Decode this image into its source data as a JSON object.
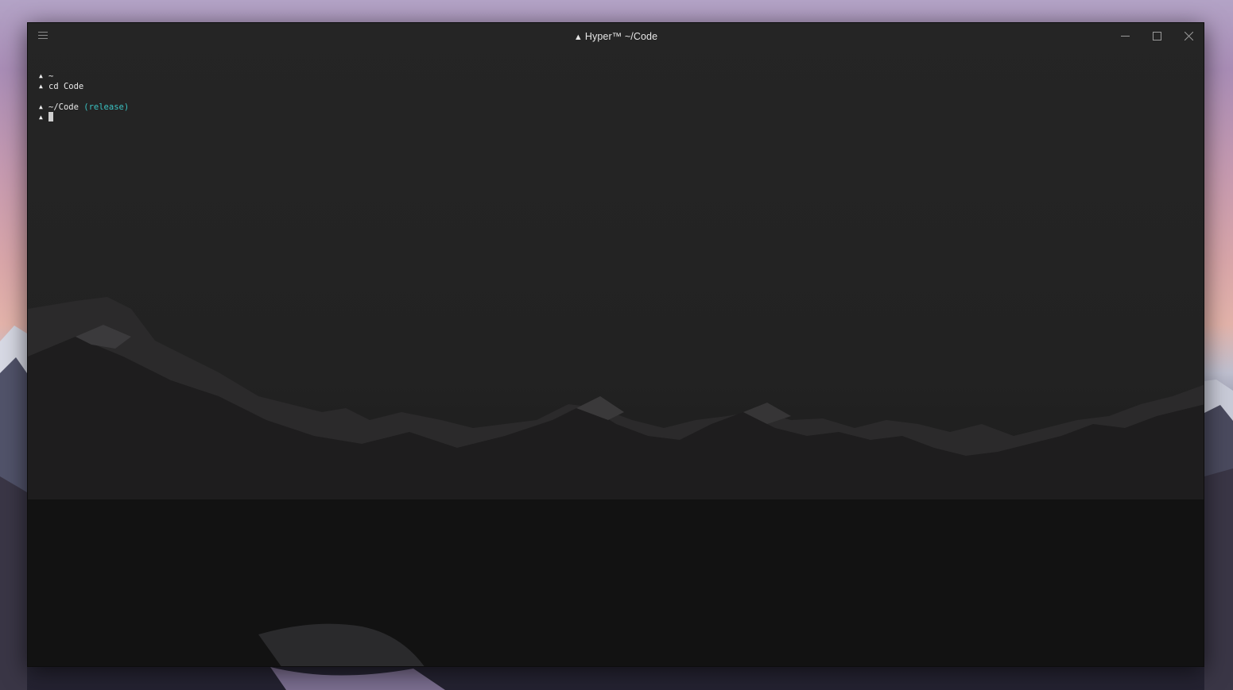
{
  "window": {
    "title": "Hyper™ ~/Code",
    "title_logo": "▲",
    "menu_icon": "hamburger-menu-icon",
    "controls": {
      "minimize_icon": "minimize-icon",
      "maximize_icon": "maximize-icon",
      "close_icon": "close-icon"
    }
  },
  "terminal": {
    "prompt_symbol": "▲",
    "lines": [
      {
        "text": "~"
      },
      {
        "text": "cd Code"
      },
      {
        "text": "~/Code",
        "branch": "(release)"
      },
      {
        "text": ""
      }
    ]
  },
  "colors": {
    "window_bg": "#232323",
    "text": "#e9e9e9",
    "branch": "#3ac2c2",
    "cursor": "#cfcfcf"
  }
}
